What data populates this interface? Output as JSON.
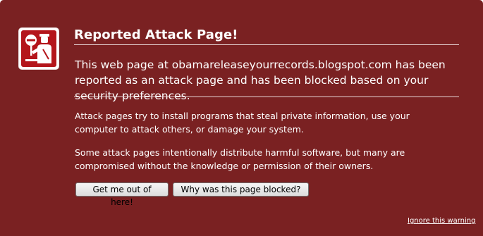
{
  "dialog": {
    "title": "Reported Attack Page!",
    "lead": "This web page at obamareleaseyourrecords.blogspot.com has been reported as an attack page and has been blocked based on your security preferences.",
    "paragraphs": [
      "Attack pages try to install programs that steal private information, use your computer to attack others, or damage your system.",
      "Some attack pages intentionally distribute harmful software, but many are compromised without the knowledge or permission of their owners."
    ],
    "buttons": {
      "get_out": "Get me out of here!",
      "why_blocked": "Why was this page blocked?"
    },
    "ignore_link": "Ignore this warning",
    "icon": "police-stop-icon"
  },
  "colors": {
    "background": "#7a2122",
    "icon_red": "#b4151b",
    "text": "#ffffff"
  }
}
